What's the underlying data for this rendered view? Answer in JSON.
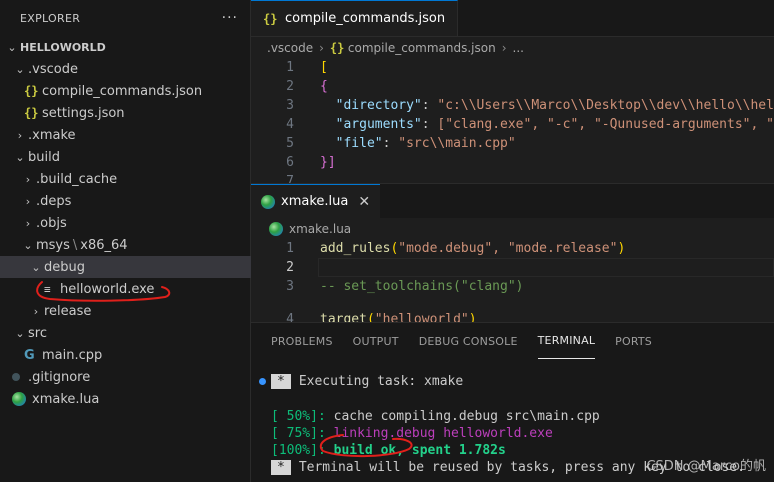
{
  "explorer": {
    "title": "EXPLORER",
    "more": "···",
    "root": "HELLOWORLD",
    "items": [
      {
        "label": ".vscode"
      },
      {
        "label": "compile_commands.json"
      },
      {
        "label": "settings.json"
      },
      {
        "label": ".xmake"
      },
      {
        "label": "build"
      },
      {
        "label": ".build_cache"
      },
      {
        "label": ".deps"
      },
      {
        "label": ".objs"
      },
      {
        "label": "msys",
        "label2": "x86_64"
      },
      {
        "label": "debug"
      },
      {
        "label": "helloworld.exe"
      },
      {
        "label": "release"
      },
      {
        "label": "src"
      },
      {
        "label": "main.cpp"
      },
      {
        "label": ".gitignore"
      },
      {
        "label": "xmake.lua"
      }
    ]
  },
  "editor1": {
    "tab": "compile_commands.json",
    "breadcrumb": [
      ".vscode",
      "compile_commands.json",
      "..."
    ],
    "lines": {
      "n1": "1",
      "n2": "2",
      "n3": "3",
      "n4": "4",
      "n5": "5",
      "n6": "6",
      "n7": "7",
      "l1": "[",
      "l2": "{",
      "l3_key": "\"directory\"",
      "l3_val": "\"c:\\\\Users\\\\Marco\\\\Desktop\\\\dev\\\\hello\\\\hell",
      "l4_key": "\"arguments\"",
      "l4_val": "[\"clang.exe\", \"-c\", \"-Qunused-arguments\", \"-",
      "l5_key": "\"file\"",
      "l5_val": "\"src\\\\main.cpp\"",
      "l6": "}]"
    }
  },
  "editor2": {
    "tab": "xmake.lua",
    "close": "✕",
    "breadcrumb": "xmake.lua",
    "lines": {
      "n1": "1",
      "n2": "2",
      "n3": "3",
      "n4": "4",
      "l1_fn": "add_rules",
      "l1_args": "\"mode.debug\", \"mode.release\"",
      "l3": "-- set_toolchains(\"clang\")",
      "l4_fn": "target",
      "l4_args": "\"helloworld\""
    }
  },
  "panel": {
    "tabs": [
      "PROBLEMS",
      "OUTPUT",
      "DEBUG CONSOLE",
      "TERMINAL",
      "PORTS"
    ],
    "active_tab": "TERMINAL",
    "terminal": {
      "task": "Executing task: xmake",
      "l1_pct": "[ 50%]:",
      "l1_rest": "cache compiling.debug src\\main.cpp",
      "l2_pct": "[ 75%]:",
      "l2_link": "linking.debug",
      "l2_file": "helloworld.exe",
      "l3_pct": "[100%]:",
      "l3_rest": "build ok, spent 1.782s",
      "l4": "Terminal will be reused by tasks, press any key to close."
    }
  },
  "watermark": "CSDN @Marco的帆"
}
